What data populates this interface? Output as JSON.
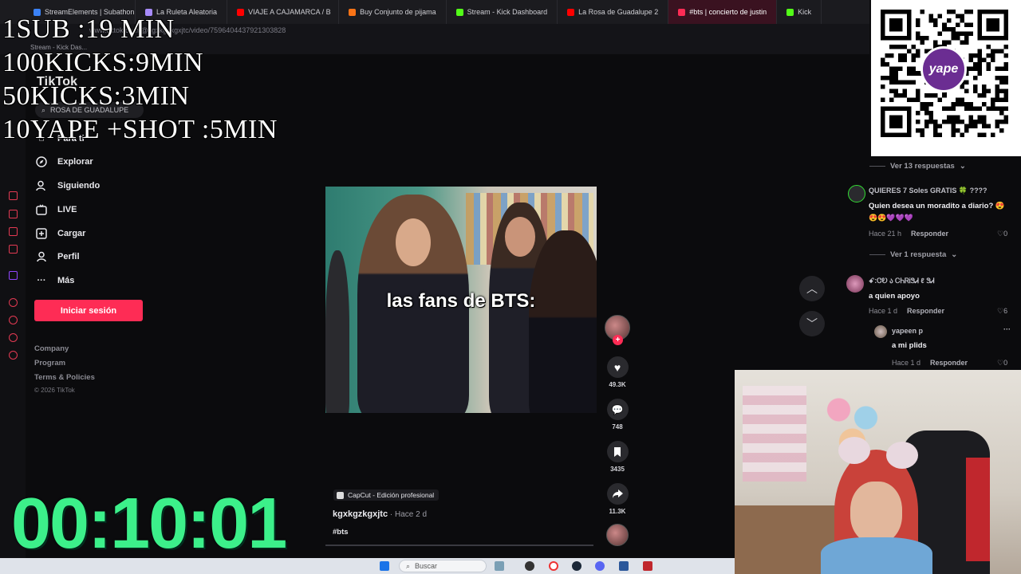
{
  "browser": {
    "tabs": [
      {
        "label": "StreamElements | Subathon",
        "color": "#3b82f6"
      },
      {
        "label": "La Ruleta Aleatoria",
        "color": "#a78bfa"
      },
      {
        "label": "VIAJE A CAJAMARCA / B",
        "color": "#ff0000"
      },
      {
        "label": "Buy Conjunto de pijama",
        "color": "#f97316"
      },
      {
        "label": "Stream - Kick Dashboard",
        "color": "#53fc18"
      },
      {
        "label": "La Rosa de Guadalupe 2",
        "color": "#ff0000"
      },
      {
        "label": "#bts | concierto de justin",
        "color": "#fe2c55"
      },
      {
        "label": "Kick",
        "color": "#53fc18"
      }
    ],
    "url": "www.tiktok.com/@kgxkgzkgxjtc/video/7596404437921303828",
    "bookmark": "Stream - Kick Das..."
  },
  "overlay": {
    "lines": [
      "1SUB :19 MIN",
      "100KICKS:9MIN",
      "50KICKS:3MIN",
      "10YAPE +SHOT :5MIN"
    ],
    "timer": "00:10:01"
  },
  "tiktok": {
    "logo": "TikTok",
    "search_placeholder": "ROSA DE GUADALUPE",
    "nav": [
      {
        "label": "Para ti",
        "icon": "home-icon"
      },
      {
        "label": "Explorar",
        "icon": "compass-icon"
      },
      {
        "label": "Siguiendo",
        "icon": "user-follow-icon"
      },
      {
        "label": "LIVE",
        "icon": "live-icon"
      },
      {
        "label": "Cargar",
        "icon": "upload-icon"
      },
      {
        "label": "Perfil",
        "icon": "profile-icon"
      },
      {
        "label": "Más",
        "icon": "more-icon"
      }
    ],
    "login_label": "Iniciar sesión",
    "footer": [
      "Company",
      "Program",
      "Terms & Policies"
    ],
    "copyright": "© 2026 TikTok",
    "video": {
      "caption": "las fans de BTS:",
      "capcut": "CapCut - Edición profesional",
      "author": "kgxkgzkgxjtc",
      "time": " · Hace 2 d",
      "hashtag": "#bts"
    },
    "actions": {
      "likes": "49.3K",
      "comments": "748",
      "saves": "3435",
      "shares": "11.3K"
    }
  },
  "comments": {
    "more1": "Ver 13 respuestas",
    "c1": {
      "user": "QUIERES 7 Soles GRATIS 🍀 ????",
      "text": "Quien desea un moradito a diario? 😍",
      "emoji": "😍😍💜💜💜",
      "time": "Hace 21 h",
      "reply": "Responder",
      "likes": "0"
    },
    "more2": "Ver 1 respuesta",
    "c2": {
      "user": "ꗃ:ᏣᎧ ა ᏟᏂᏒᎥᏕᏗ ℓ ᏕᏗ",
      "text": "a quien apoyo",
      "time": "Hace 1 d",
      "reply": "Responder",
      "likes": "6"
    },
    "c3": {
      "user": "yapeen p",
      "text": "a mi plids",
      "time": "Hace 1 d",
      "reply": "Responder",
      "likes": "0"
    }
  },
  "qr": {
    "brand": "yape",
    "color": "#6b2d92"
  },
  "taskbar": {
    "search": "Buscar"
  },
  "colors": {
    "accent": "#fe2c55",
    "timer": "#3cf08a"
  }
}
